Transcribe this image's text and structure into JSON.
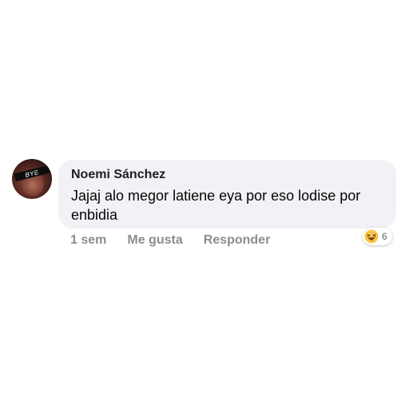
{
  "comment": {
    "author": "Noemi Sánchez",
    "text": "Jajaj alo megor latiene eya por eso lodise por enbidia",
    "avatar_caption": "BYE",
    "timestamp": "1 sem",
    "like_label": "Me gusta",
    "reply_label": "Responder",
    "reaction": {
      "icon": "laughing-emoji-icon",
      "count": "6"
    }
  },
  "colors": {
    "bubble_bg": "#f0f2f5",
    "author_text": "#1c1e21",
    "body_text": "#050505",
    "action_text": "#8a8d91",
    "emoji_face": "#f7c64a"
  }
}
